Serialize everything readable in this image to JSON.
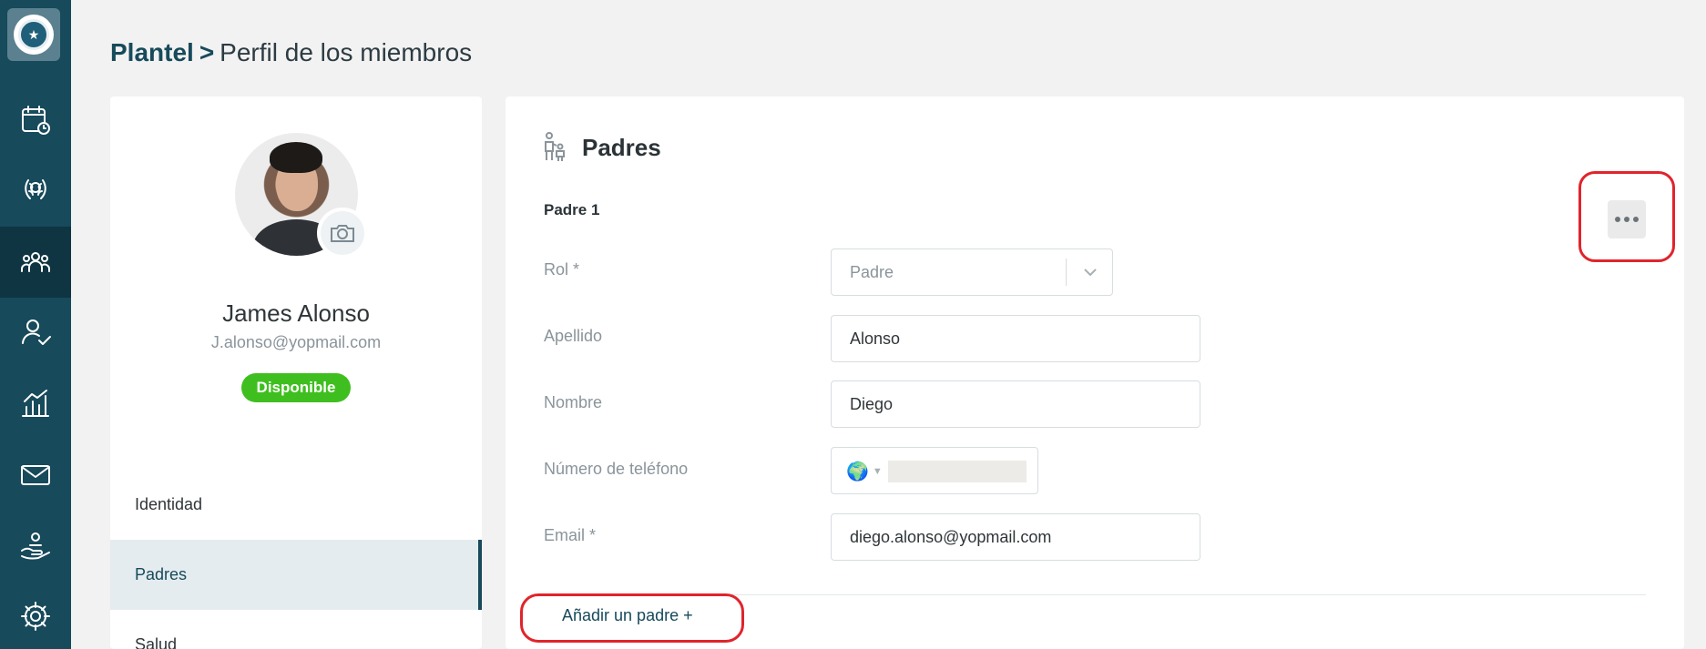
{
  "breadcrumb": {
    "root": "Plantel",
    "separator": ">",
    "current": "Perfil de los miembros"
  },
  "sidebar": {
    "items": [
      {
        "icon": "calendar-clock-icon"
      },
      {
        "icon": "laurel-icon"
      },
      {
        "icon": "team-icon",
        "active": true
      },
      {
        "icon": "user-check-icon"
      },
      {
        "icon": "stats-icon"
      },
      {
        "icon": "mail-icon"
      },
      {
        "icon": "hand-care-icon"
      },
      {
        "icon": "gear-icon"
      }
    ]
  },
  "profile": {
    "name": "James Alonso",
    "email": "J.alonso@yopmail.com",
    "status": "Disponible",
    "status_color": "#3fbf1f"
  },
  "profile_menu": [
    {
      "label": "Identidad"
    },
    {
      "label": "Padres",
      "active": true
    },
    {
      "label": "Salud"
    }
  ],
  "section": {
    "title": "Padres",
    "parent_label": "Padre 1",
    "fields": {
      "rol": {
        "label": "Rol *",
        "value": "Padre"
      },
      "apellido": {
        "label": "Apellido",
        "value": "Alonso"
      },
      "nombre": {
        "label": "Nombre",
        "value": "Diego"
      },
      "telefono": {
        "label": "Número de teléfono",
        "value": ""
      },
      "email": {
        "label": "Email *",
        "value": "diego.alonso@yopmail.com"
      }
    },
    "add_parent": "Añadir un padre +"
  },
  "colors": {
    "sidebar": "#174a5b",
    "accent": "#174a5b",
    "highlight": "#e0242b"
  }
}
